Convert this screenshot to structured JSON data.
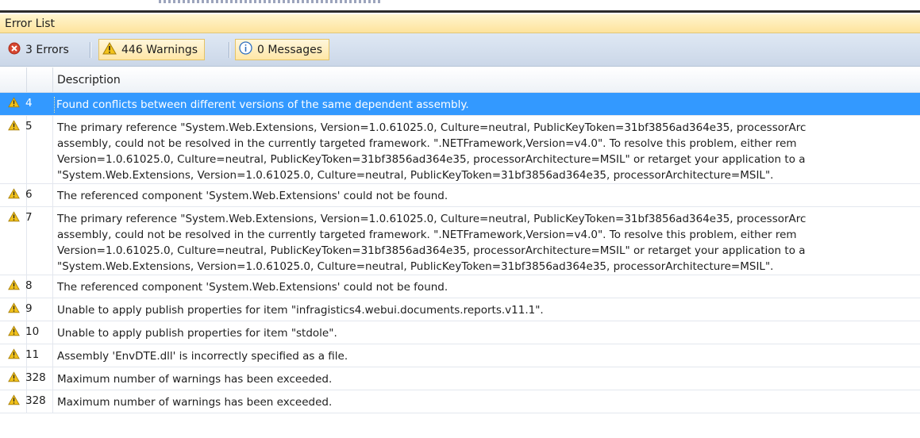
{
  "panel": {
    "title": "Error List"
  },
  "filters": {
    "errors_label": "3 Errors",
    "warnings_label": "446 Warnings",
    "messages_label": "0 Messages"
  },
  "columns": {
    "description": "Description"
  },
  "rows": [
    {
      "num": "4",
      "lines": [
        "Found conflicts between different versions of the same dependent assembly."
      ],
      "selected": true,
      "icon": "warning-icon"
    },
    {
      "num": "5",
      "lines": [
        "The primary reference \"System.Web.Extensions, Version=1.0.61025.0, Culture=neutral, PublicKeyToken=31bf3856ad364e35, processorArc",
        "assembly, could not be resolved in the currently targeted framework. \".NETFramework,Version=v4.0\". To resolve this problem, either rem",
        "Version=1.0.61025.0, Culture=neutral, PublicKeyToken=31bf3856ad364e35, processorArchitecture=MSIL\" or retarget your application to a",
        "\"System.Web.Extensions, Version=1.0.61025.0, Culture=neutral, PublicKeyToken=31bf3856ad364e35, processorArchitecture=MSIL\"."
      ],
      "icon": "warning-icon"
    },
    {
      "num": "6",
      "lines": [
        "The referenced component 'System.Web.Extensions' could not be found."
      ],
      "icon": "warning-icon"
    },
    {
      "num": "7",
      "lines": [
        "The primary reference \"System.Web.Extensions, Version=1.0.61025.0, Culture=neutral, PublicKeyToken=31bf3856ad364e35, processorArc",
        "assembly, could not be resolved in the currently targeted framework. \".NETFramework,Version=v4.0\". To resolve this problem, either rem",
        "Version=1.0.61025.0, Culture=neutral, PublicKeyToken=31bf3856ad364e35, processorArchitecture=MSIL\" or retarget your application to a",
        "\"System.Web.Extensions, Version=1.0.61025.0, Culture=neutral, PublicKeyToken=31bf3856ad364e35, processorArchitecture=MSIL\"."
      ],
      "icon": "warning-icon"
    },
    {
      "num": "8",
      "lines": [
        "The referenced component 'System.Web.Extensions' could not be found."
      ],
      "icon": "warning-icon"
    },
    {
      "num": "9",
      "lines": [
        "Unable to apply publish properties for item \"infragistics4.webui.documents.reports.v11.1\"."
      ],
      "icon": "warning-icon"
    },
    {
      "num": "10",
      "lines": [
        "Unable to apply publish properties for item \"stdole\"."
      ],
      "icon": "warning-icon"
    },
    {
      "num": "11",
      "lines": [
        "Assembly 'EnvDTE.dll' is incorrectly specified as a file."
      ],
      "icon": "warning-icon"
    },
    {
      "num": "328",
      "lines": [
        "Maximum number of warnings has been exceeded."
      ],
      "icon": "warning-icon"
    },
    {
      "num": "328",
      "lines": [
        "Maximum number of warnings has been exceeded."
      ],
      "icon": "warning-icon"
    }
  ],
  "colors": {
    "selection": "#3399ff",
    "warning": "#f2c21b",
    "error": "#d6452f",
    "info": "#2f6fbf"
  }
}
